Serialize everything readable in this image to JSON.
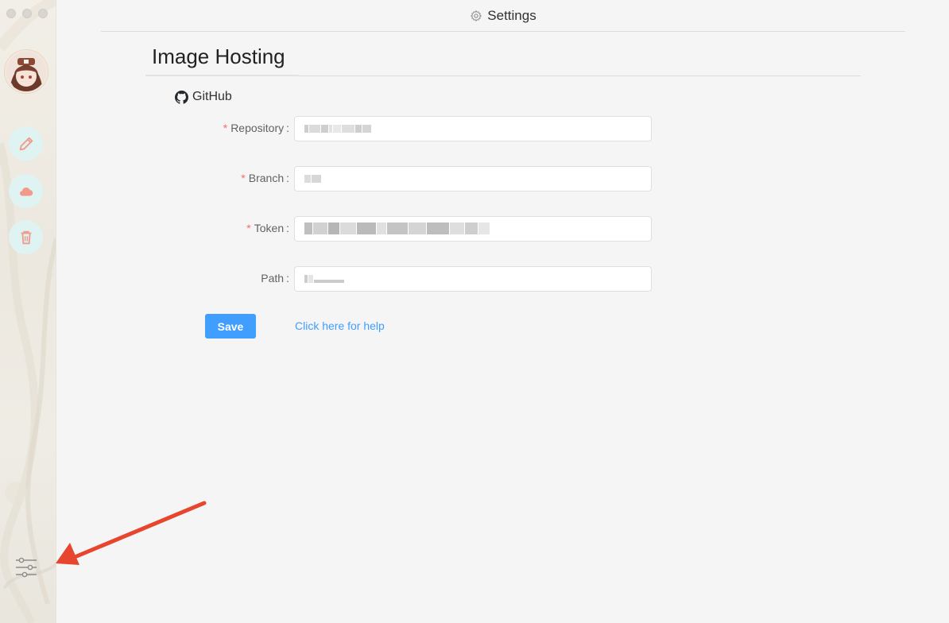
{
  "window": {
    "title": "Settings"
  },
  "sidebar": {
    "nav": [
      {
        "icon": "pencil-icon"
      },
      {
        "icon": "cloud-icon"
      },
      {
        "icon": "trash-icon"
      }
    ],
    "settings_icon": "sliders-icon"
  },
  "section": {
    "heading": "Image Hosting"
  },
  "provider": {
    "label": "GitHub",
    "icon": "github-icon"
  },
  "form": {
    "fields": [
      {
        "label": "Repository",
        "required": "*",
        "value": ""
      },
      {
        "label": "Branch",
        "required": "*",
        "value": ""
      },
      {
        "label": "Token",
        "required": "*",
        "value": ""
      },
      {
        "label": "Path",
        "required": "",
        "value": ""
      }
    ],
    "colon": ":",
    "save_label": "Save",
    "help_label": "Click here for help"
  },
  "colors": {
    "accent": "#409eff",
    "required": "#f56c6c",
    "nav_bg": "#dff4f2",
    "nav_icon": "#f29a8a",
    "arrow": "#e8452f"
  }
}
